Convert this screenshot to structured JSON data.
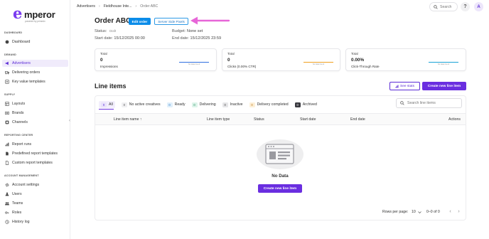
{
  "brand": {
    "logo_glyph": "e",
    "logo_word": "mperor",
    "logo_sub": "powered by primedx",
    "accent": "#6a2ee0"
  },
  "sidebar": {
    "sections": [
      {
        "title": "DASHBOARD",
        "items": [
          {
            "label": "Dashboard",
            "icon": "dashboard-icon"
          }
        ]
      },
      {
        "title": "DEMAND",
        "items": [
          {
            "label": "Advertisers",
            "icon": "megaphone-icon",
            "active": true
          },
          {
            "label": "Delivering orders",
            "icon": "truck-icon"
          },
          {
            "label": "Key value templates",
            "icon": "key-icon"
          }
        ]
      },
      {
        "title": "SUPPLY",
        "items": [
          {
            "label": "Layouts",
            "icon": "layout-icon"
          },
          {
            "label": "Brands",
            "icon": "brand-icon"
          },
          {
            "label": "Channels",
            "icon": "channels-icon"
          }
        ]
      },
      {
        "title": "REPORTING CENTER",
        "items": [
          {
            "label": "Report runs",
            "icon": "chart-icon"
          },
          {
            "label": "Predefined report templates",
            "icon": "document-icon"
          },
          {
            "label": "Custom report templates",
            "icon": "document-icon"
          }
        ]
      },
      {
        "title": "ACCOUNT MANAGEMENT",
        "items": [
          {
            "label": "Account settings",
            "icon": "gear-icon"
          },
          {
            "label": "Users",
            "icon": "user-icon"
          },
          {
            "label": "Teams",
            "icon": "team-icon"
          },
          {
            "label": "Roles",
            "icon": "key-icon"
          },
          {
            "label": "History log",
            "icon": "history-icon"
          }
        ]
      }
    ]
  },
  "topbar": {
    "breadcrumb": [
      "Advertisers",
      "Fieldhouse Inte...",
      "Order ABC"
    ],
    "breadcrumb_sep": "›",
    "search_label": "Search",
    "help_label": "?",
    "avatar_initial": "A"
  },
  "order": {
    "title": "Order ABC",
    "edit_label": "Edit order",
    "ssp_label": "Server Side Pixels",
    "status_key": "Status:",
    "status_value": "Draft",
    "budget_key": "Budget:",
    "budget_value": "None set",
    "start_key": "Start date:",
    "start_value": "15/12/2025 00:00",
    "end_key": "End date:",
    "end_value": "15/12/2025 23:59"
  },
  "stats": [
    {
      "title": "Total",
      "value": "0",
      "label": "Impressions",
      "no_data": "No data found",
      "color": "#2f6fe0"
    },
    {
      "title": "Total",
      "value": "0",
      "label": "Clicks (0.00% CTR)",
      "no_data": "No data found",
      "color": "#f0a020"
    },
    {
      "title": "Total",
      "value": "0.00%",
      "label": "Click-Through Rate",
      "no_data": "No data found",
      "color": "#1aa3d6"
    }
  ],
  "line_items": {
    "title": "Line items",
    "see_stats_label": "See stats",
    "create_label": "Create new line item",
    "search_placeholder": "Search line items",
    "tabs": [
      {
        "count": "0",
        "label": "All",
        "badge_bg": "#e9e2fb",
        "badge_fg": "#5b2bd6"
      },
      {
        "count": "0",
        "label": "No active creatives",
        "badge_bg": "#f0f0f2",
        "badge_fg": "#555"
      },
      {
        "count": "0",
        "label": "Ready",
        "badge_bg": "#e1f0fb",
        "badge_fg": "#1b72c2"
      },
      {
        "count": "0",
        "label": "Delivering",
        "badge_bg": "#ddf4ea",
        "badge_fg": "#1d8a5b"
      },
      {
        "count": "0",
        "label": "Inactive",
        "badge_bg": "#e6e6e8",
        "badge_fg": "#444"
      },
      {
        "count": "0",
        "label": "Delivery completed",
        "badge_bg": "#fdf0d8",
        "badge_fg": "#b8700c"
      },
      {
        "count": "0",
        "label": "Archived",
        "badge_bg": "#3a3a40",
        "badge_fg": "#ffffff"
      }
    ],
    "columns": [
      "Line item name",
      "Line item type",
      "Status",
      "Start date",
      "End date",
      "Actions"
    ],
    "sort_arrow": "↑",
    "empty_text": "No Data",
    "empty_create_label": "Create new line item",
    "rows_per_page_label": "Rows per page:",
    "rows_per_page_value": "10",
    "range_text": "0–0 of 0"
  }
}
